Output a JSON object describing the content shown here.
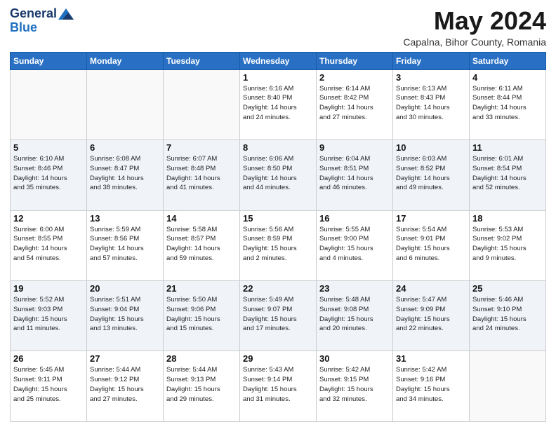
{
  "header": {
    "logo_general": "General",
    "logo_blue": "Blue",
    "month_title": "May 2024",
    "subtitle": "Capalna, Bihor County, Romania"
  },
  "weekdays": [
    "Sunday",
    "Monday",
    "Tuesday",
    "Wednesday",
    "Thursday",
    "Friday",
    "Saturday"
  ],
  "weeks": [
    [
      {
        "day": "",
        "info": ""
      },
      {
        "day": "",
        "info": ""
      },
      {
        "day": "",
        "info": ""
      },
      {
        "day": "1",
        "info": "Sunrise: 6:16 AM\nSunset: 8:40 PM\nDaylight: 14 hours\nand 24 minutes."
      },
      {
        "day": "2",
        "info": "Sunrise: 6:14 AM\nSunset: 8:42 PM\nDaylight: 14 hours\nand 27 minutes."
      },
      {
        "day": "3",
        "info": "Sunrise: 6:13 AM\nSunset: 8:43 PM\nDaylight: 14 hours\nand 30 minutes."
      },
      {
        "day": "4",
        "info": "Sunrise: 6:11 AM\nSunset: 8:44 PM\nDaylight: 14 hours\nand 33 minutes."
      }
    ],
    [
      {
        "day": "5",
        "info": "Sunrise: 6:10 AM\nSunset: 8:46 PM\nDaylight: 14 hours\nand 35 minutes."
      },
      {
        "day": "6",
        "info": "Sunrise: 6:08 AM\nSunset: 8:47 PM\nDaylight: 14 hours\nand 38 minutes."
      },
      {
        "day": "7",
        "info": "Sunrise: 6:07 AM\nSunset: 8:48 PM\nDaylight: 14 hours\nand 41 minutes."
      },
      {
        "day": "8",
        "info": "Sunrise: 6:06 AM\nSunset: 8:50 PM\nDaylight: 14 hours\nand 44 minutes."
      },
      {
        "day": "9",
        "info": "Sunrise: 6:04 AM\nSunset: 8:51 PM\nDaylight: 14 hours\nand 46 minutes."
      },
      {
        "day": "10",
        "info": "Sunrise: 6:03 AM\nSunset: 8:52 PM\nDaylight: 14 hours\nand 49 minutes."
      },
      {
        "day": "11",
        "info": "Sunrise: 6:01 AM\nSunset: 8:54 PM\nDaylight: 14 hours\nand 52 minutes."
      }
    ],
    [
      {
        "day": "12",
        "info": "Sunrise: 6:00 AM\nSunset: 8:55 PM\nDaylight: 14 hours\nand 54 minutes."
      },
      {
        "day": "13",
        "info": "Sunrise: 5:59 AM\nSunset: 8:56 PM\nDaylight: 14 hours\nand 57 minutes."
      },
      {
        "day": "14",
        "info": "Sunrise: 5:58 AM\nSunset: 8:57 PM\nDaylight: 14 hours\nand 59 minutes."
      },
      {
        "day": "15",
        "info": "Sunrise: 5:56 AM\nSunset: 8:59 PM\nDaylight: 15 hours\nand 2 minutes."
      },
      {
        "day": "16",
        "info": "Sunrise: 5:55 AM\nSunset: 9:00 PM\nDaylight: 15 hours\nand 4 minutes."
      },
      {
        "day": "17",
        "info": "Sunrise: 5:54 AM\nSunset: 9:01 PM\nDaylight: 15 hours\nand 6 minutes."
      },
      {
        "day": "18",
        "info": "Sunrise: 5:53 AM\nSunset: 9:02 PM\nDaylight: 15 hours\nand 9 minutes."
      }
    ],
    [
      {
        "day": "19",
        "info": "Sunrise: 5:52 AM\nSunset: 9:03 PM\nDaylight: 15 hours\nand 11 minutes."
      },
      {
        "day": "20",
        "info": "Sunrise: 5:51 AM\nSunset: 9:04 PM\nDaylight: 15 hours\nand 13 minutes."
      },
      {
        "day": "21",
        "info": "Sunrise: 5:50 AM\nSunset: 9:06 PM\nDaylight: 15 hours\nand 15 minutes."
      },
      {
        "day": "22",
        "info": "Sunrise: 5:49 AM\nSunset: 9:07 PM\nDaylight: 15 hours\nand 17 minutes."
      },
      {
        "day": "23",
        "info": "Sunrise: 5:48 AM\nSunset: 9:08 PM\nDaylight: 15 hours\nand 20 minutes."
      },
      {
        "day": "24",
        "info": "Sunrise: 5:47 AM\nSunset: 9:09 PM\nDaylight: 15 hours\nand 22 minutes."
      },
      {
        "day": "25",
        "info": "Sunrise: 5:46 AM\nSunset: 9:10 PM\nDaylight: 15 hours\nand 24 minutes."
      }
    ],
    [
      {
        "day": "26",
        "info": "Sunrise: 5:45 AM\nSunset: 9:11 PM\nDaylight: 15 hours\nand 25 minutes."
      },
      {
        "day": "27",
        "info": "Sunrise: 5:44 AM\nSunset: 9:12 PM\nDaylight: 15 hours\nand 27 minutes."
      },
      {
        "day": "28",
        "info": "Sunrise: 5:44 AM\nSunset: 9:13 PM\nDaylight: 15 hours\nand 29 minutes."
      },
      {
        "day": "29",
        "info": "Sunrise: 5:43 AM\nSunset: 9:14 PM\nDaylight: 15 hours\nand 31 minutes."
      },
      {
        "day": "30",
        "info": "Sunrise: 5:42 AM\nSunset: 9:15 PM\nDaylight: 15 hours\nand 32 minutes."
      },
      {
        "day": "31",
        "info": "Sunrise: 5:42 AM\nSunset: 9:16 PM\nDaylight: 15 hours\nand 34 minutes."
      },
      {
        "day": "",
        "info": ""
      }
    ]
  ]
}
